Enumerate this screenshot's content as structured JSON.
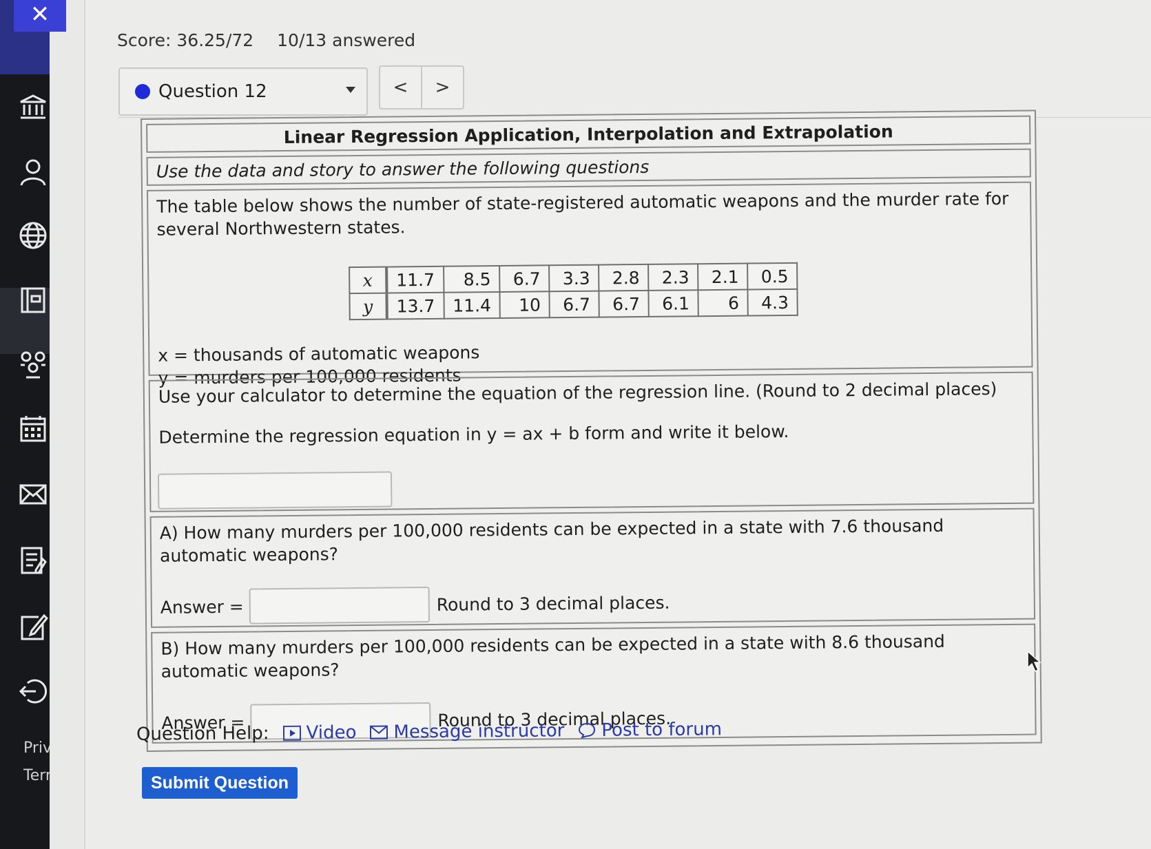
{
  "score": {
    "label": "Score: 36.25/72",
    "answered": "10/13 answered"
  },
  "question_select": {
    "label": "Question 12"
  },
  "nav": {
    "prev": "<",
    "next": ">"
  },
  "sidebar": {
    "close": "✕",
    "items": [
      "institution-icon",
      "profile-icon",
      "globe-icon",
      "courses-icon",
      "groups-icon",
      "calendar-icon",
      "inbox-icon",
      "history-icon",
      "edit-icon",
      "logout-icon"
    ],
    "footer": [
      "Priv",
      "Terr"
    ]
  },
  "panel": {
    "title": "Linear Regression Application, Interpolation and Extrapolation",
    "subtitle": "Use the data and story to answer the following questions",
    "story": "The table below shows the number of state-registered automatic weapons and the murder rate for several Northwestern states.",
    "table": {
      "x_label": "x",
      "y_label": "y",
      "x": [
        "11.7",
        "8.5",
        "6.7",
        "3.3",
        "2.8",
        "2.3",
        "2.1",
        "0.5"
      ],
      "y": [
        "13.7",
        "11.4",
        "10",
        "6.7",
        "6.7",
        "6.1",
        "6",
        "4.3"
      ]
    },
    "def_x": "x = thousands of automatic weapons",
    "def_y": "y = murders per 100,000 residents",
    "regress_instr": "Use your calculator to determine the equation of the regression line. (Round to 2 decimal places)",
    "regress_form": "Determine the regression equation in y = ax + b form and write it below.",
    "partA_q": "A) How many murders per 100,000 residents can be expected in a state with 7.6 thousand automatic weapons?",
    "partB_q": "B) How many murders per 100,000 residents can be expected in a state with 8.6 thousand automatic weapons?",
    "answer_label": "Answer =",
    "round_hint": "Round to 3 decimal places."
  },
  "help": {
    "label": "Question Help:",
    "video": "Video",
    "message": "Message instructor",
    "forum": "Post to forum"
  },
  "submit": "Submit Question",
  "colors": {
    "accent": "#1d5fd0",
    "dot": "#1f2bd8",
    "link": "#2a3aa8",
    "sidebar": "#17181c"
  }
}
